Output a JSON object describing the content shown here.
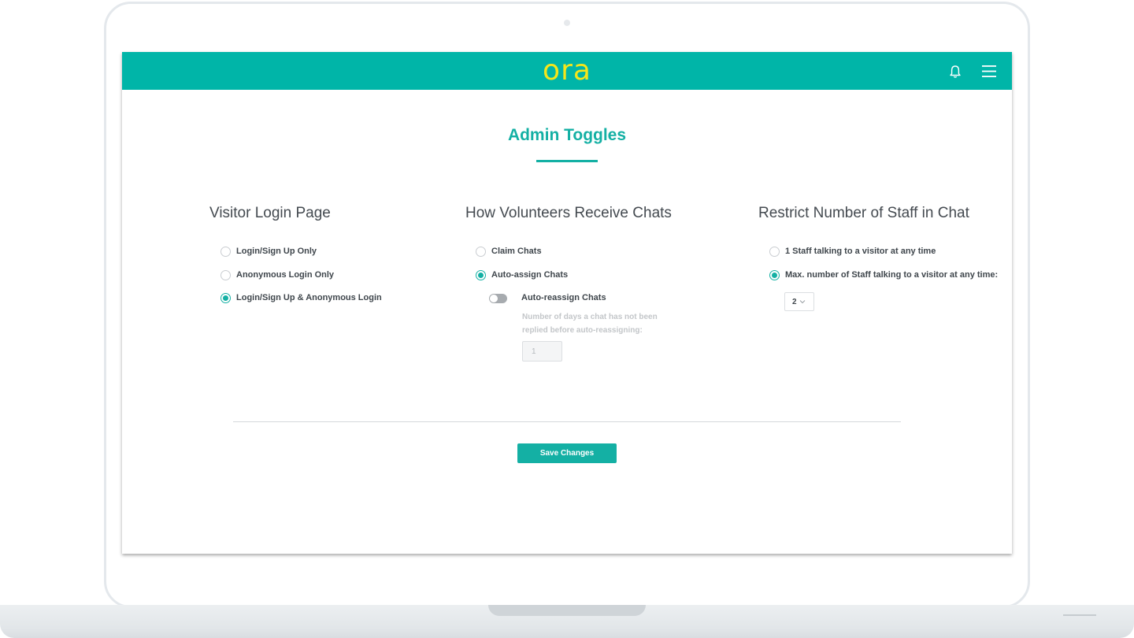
{
  "app": {
    "logo_text": "ora"
  },
  "header": {
    "notifications_icon": "bell-icon",
    "menu_icon": "hamburger-menu-icon"
  },
  "page": {
    "title": "Admin Toggles"
  },
  "colors": {
    "brand_teal": "#00b5a8",
    "logo_yellow": "#f5e61a",
    "accent": "#14b0a4"
  },
  "sections": {
    "visitor_login": {
      "heading": "Visitor Login Page",
      "options": [
        {
          "label": "Login/Sign Up Only",
          "selected": false
        },
        {
          "label": "Anonymous Login Only",
          "selected": false
        },
        {
          "label": "Login/Sign Up & Anonymous Login",
          "selected": true
        }
      ]
    },
    "volunteer_chats": {
      "heading": "How Volunteers Receive Chats",
      "options": [
        {
          "label": "Claim Chats",
          "selected": false
        },
        {
          "label": "Auto-assign Chats",
          "selected": true
        }
      ],
      "auto_reassign": {
        "label": "Auto-reassign Chats",
        "enabled": false,
        "help_text": "Number of days a chat has not been replied before auto-reassigning:",
        "days_value": "1"
      }
    },
    "staff_limit": {
      "heading": "Restrict Number of Staff in Chat",
      "options": [
        {
          "label": "1 Staff talking to a visitor at any time",
          "selected": false
        },
        {
          "label": "Max. number of Staff talking to a visitor at any time:",
          "selected": true
        }
      ],
      "max_staff_value": "2"
    }
  },
  "actions": {
    "save_label": "Save Changes"
  }
}
